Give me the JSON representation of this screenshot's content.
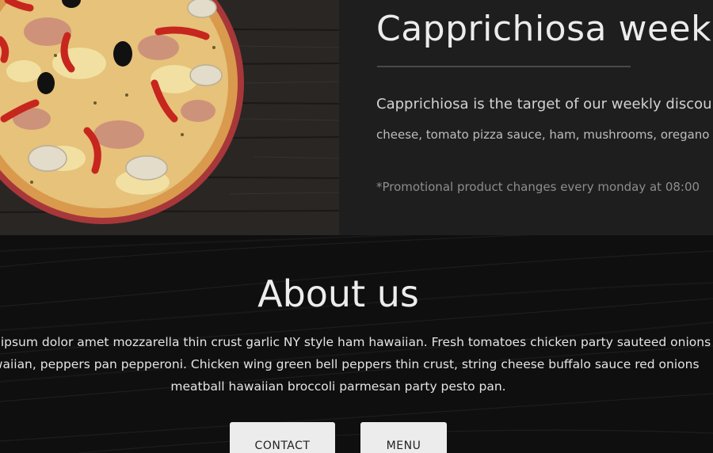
{
  "promo": {
    "title": "Capprichiosa week",
    "lead": "Capprichiosa is the target of our weekly discount",
    "ingredients": "cheese, tomato pizza sauce, ham, mushrooms, oregano",
    "note": "*Promotional product changes every monday at 08:00"
  },
  "about": {
    "title": "About us",
    "body": "Pizza ipsum dolor amet mozzarella thin crust garlic NY style ham hawaiian. Fresh tomatoes chicken party sauteed onions hawaiian, peppers pan pepperoni. Chicken wing green bell peppers thin crust, string cheese buffalo sauce red onions meatball hawaiian broccoli parmesan party pesto pan."
  },
  "buttons": {
    "contact": "CONTACT",
    "menu": "MENU"
  },
  "colors": {
    "background": "#121212",
    "panel": "#1e1e1e",
    "button": "#ececec",
    "text": "#ececec"
  }
}
